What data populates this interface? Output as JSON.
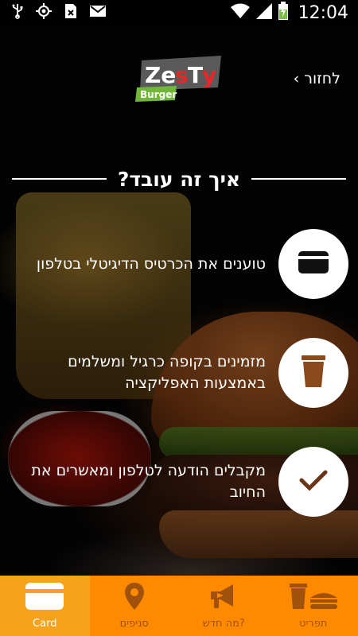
{
  "status_bar": {
    "time": "12:04",
    "icons": [
      "usb-icon",
      "gps-icon",
      "no-sim-icon",
      "gmail-icon",
      "wifi-icon",
      "signal-icon",
      "battery-charging-icon"
    ]
  },
  "header": {
    "logo_text": "ZesTy Burger",
    "back_label": "לחזור ›"
  },
  "section_title": "איך זה עובד?",
  "steps": [
    {
      "icon": "credit-card-icon",
      "text": "טוענים את הכרטיס הדיגיטלי בטלפון"
    },
    {
      "icon": "cup-icon",
      "text": "מזמינים בקופה כרגיל ומשלמים באמצעות האפליקציה"
    },
    {
      "icon": "checkmark-icon",
      "text": "מקבלים הודעה לטלפון ומאשרים את החיוב"
    }
  ],
  "tabs": [
    {
      "label": "Card",
      "icon": "card-icon",
      "active": true
    },
    {
      "label": "סניפים",
      "icon": "location-pin-icon",
      "active": false
    },
    {
      "label": "מה חדש?",
      "icon": "megaphone-icon",
      "active": false
    },
    {
      "label": "תפריט",
      "icon": "menu-food-icon",
      "active": false
    }
  ],
  "colors": {
    "tab_bar": "#ff8a00",
    "tab_active": "#f7a21b",
    "icon_brown": "#8a4a1c",
    "logo_red": "#e8262a",
    "logo_green": "#6fb63a"
  }
}
